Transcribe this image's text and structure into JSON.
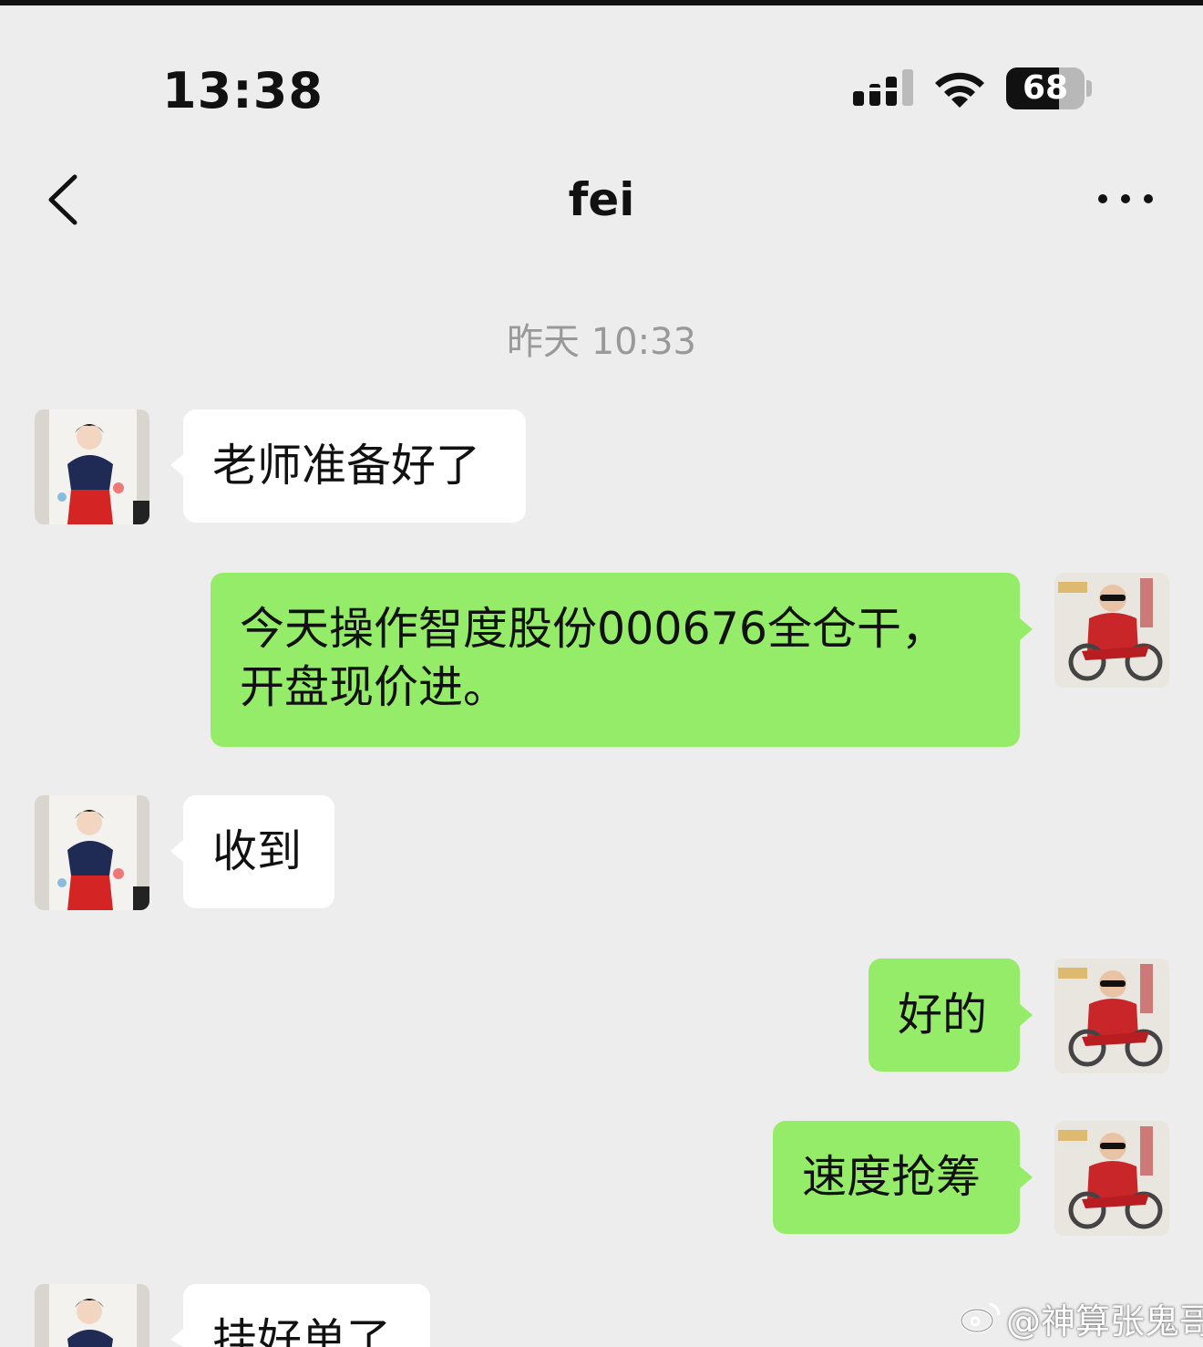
{
  "status_bar": {
    "time": "13:38",
    "battery": "68",
    "battery_level": 0.68
  },
  "header": {
    "title": "fei"
  },
  "timestamp": "昨天 10:33",
  "messages": [
    {
      "side": "in",
      "text": "老师准备好了"
    },
    {
      "side": "out",
      "text": "今天操作智度股份000676全仓干，开盘现价进。"
    },
    {
      "side": "in",
      "text": "收到"
    },
    {
      "side": "out",
      "text": "好的"
    },
    {
      "side": "out",
      "text": "速度抢筹"
    },
    {
      "side": "in",
      "text": "挂好单了"
    }
  ],
  "watermark": "@神算张鬼哥"
}
